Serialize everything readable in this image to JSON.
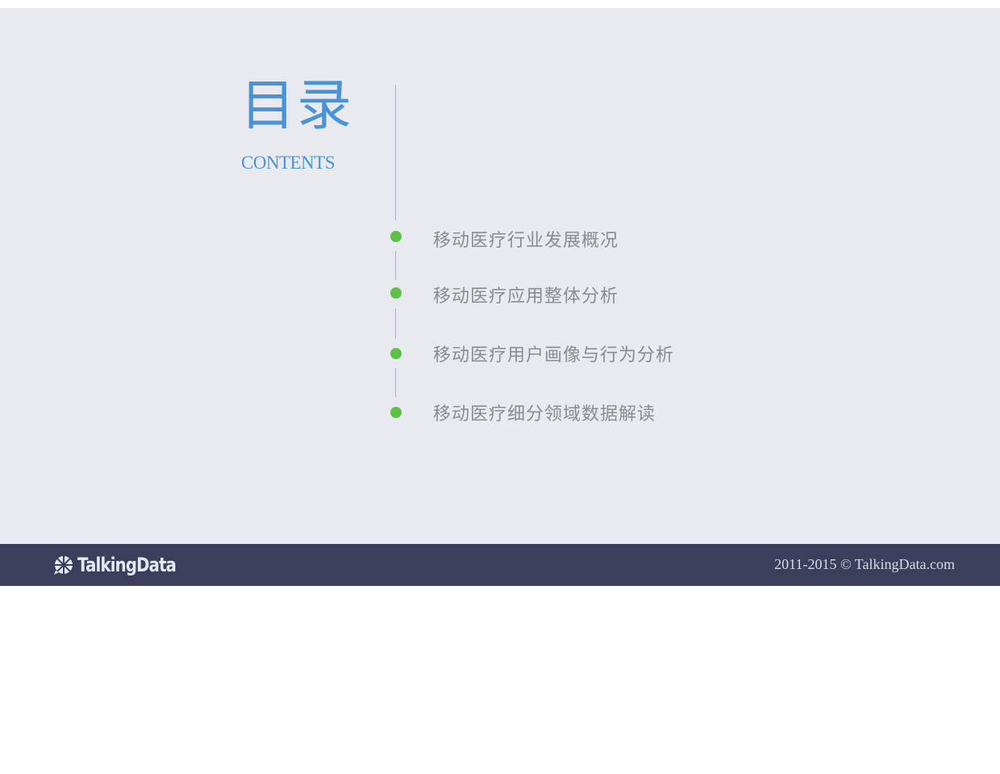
{
  "slide": {
    "title_cn": "目录",
    "title_en": "CONTENTS",
    "items": [
      {
        "label": "移动医疗行业发展概况"
      },
      {
        "label": "移动医疗应用整体分析"
      },
      {
        "label": "移动医疗用户画像与行为分析"
      },
      {
        "label": "移动医疗细分领域数据解读"
      }
    ]
  },
  "footer": {
    "logo_text": "TalkingData",
    "copyright": "2011-2015 © TalkingData.com"
  },
  "colors": {
    "title": "#4a93d6",
    "bullet": "#5cc246",
    "item_text": "#8a8c92",
    "slide_background": "#e9eaf0",
    "footer_background": "#3b3f5c"
  },
  "icons": {
    "logo": "talkingdata-logo-icon",
    "bullet": "green-dot-bullet"
  }
}
